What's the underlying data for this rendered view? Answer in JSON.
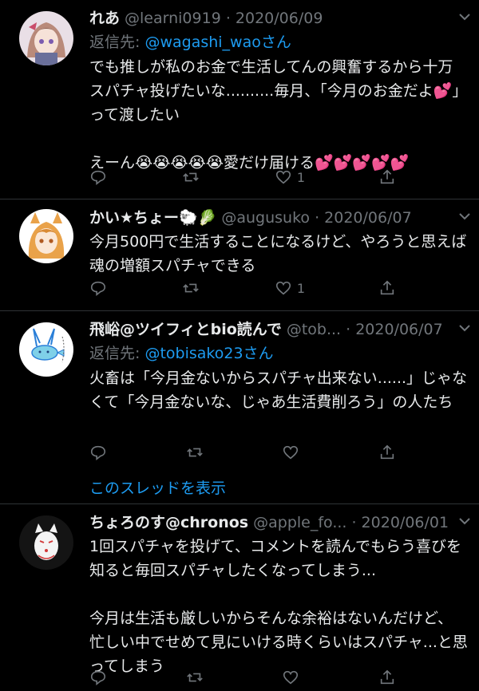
{
  "tweets": [
    {
      "name": "れあ",
      "meta": "@learni0919 · 2020/06/09",
      "reply_prefix": "返信先: ",
      "reply_to": "@wagashi_waoさん",
      "text": "でも推しが私のお金で生活してんの興奮するから十万スパチャ投げたいな..........毎月、「今月のお金だよ💕」って渡したい\n\nえーん😭😭😭😭😭愛だけ届ける💕💕💕💕💕",
      "likes": "1",
      "avatar_icon": "anime-girl-avatar"
    },
    {
      "name": "かい★ちょー🐑🥬",
      "meta": "@augusuko · 2020/06/07",
      "text": "今月500円で生活することになるけど、やろうと思えば魂の増額スパチャできる",
      "likes": "1",
      "avatar_icon": "orange-hair-girl-avatar"
    },
    {
      "name": "飛峪@ツイフィとbio読んで",
      "meta": "@tob... · 2020/06/07",
      "reply_prefix": "返信先: ",
      "reply_to": "@tobisako23さん",
      "text": "火畜は「今月金ないからスパチャ出来ない......」じゃなくて「今月金ないな、じゃあ生活費削ろう」の人たち",
      "likes": "",
      "thread_link": "このスレッドを表示",
      "avatar_icon": "rabbit-drawing-avatar"
    },
    {
      "name": "ちょろのす@chronos",
      "meta": "@apple_fo... · 2020/06/01",
      "text": "1回スパチャを投げて、コメントを読んでもらう喜びを知ると毎回スパチャしたくなってしまう...\n\n今月は生活も厳しいからそんな余裕はないんだけど、忙しい中でせめて見にいける時くらいはスパチャ...と思ってしまう",
      "likes": "",
      "avatar_icon": "fox-mask-avatar"
    }
  ]
}
